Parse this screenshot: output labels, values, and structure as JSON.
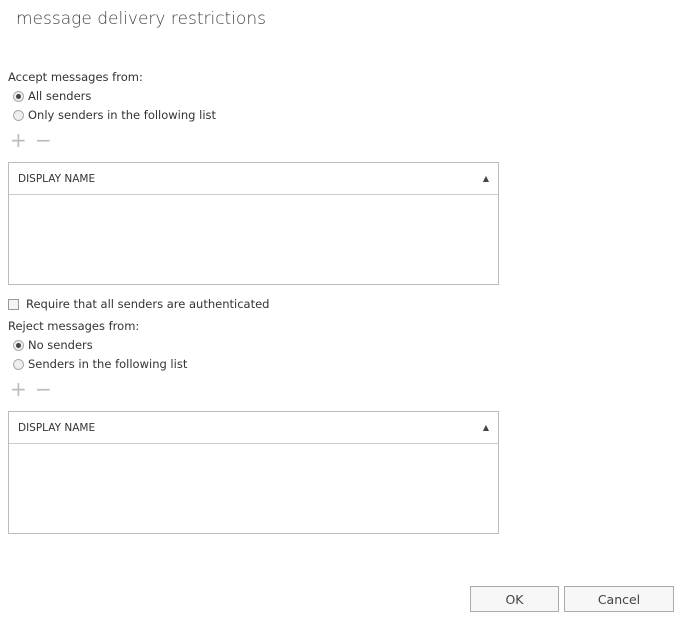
{
  "title": "message delivery restrictions",
  "accept": {
    "label": "Accept messages from:",
    "options": [
      "All senders",
      "Only senders in the following list"
    ],
    "selected": 0,
    "column": "DISPLAY NAME",
    "add": "+",
    "remove": "−"
  },
  "require_auth": {
    "label": "Require that all senders are authenticated",
    "checked": false
  },
  "reject": {
    "label": "Reject messages from:",
    "options": [
      "No senders",
      "Senders in the following list"
    ],
    "selected": 0,
    "column": "DISPLAY NAME",
    "add": "+",
    "remove": "−"
  },
  "buttons": {
    "ok": "OK",
    "cancel": "Cancel"
  }
}
